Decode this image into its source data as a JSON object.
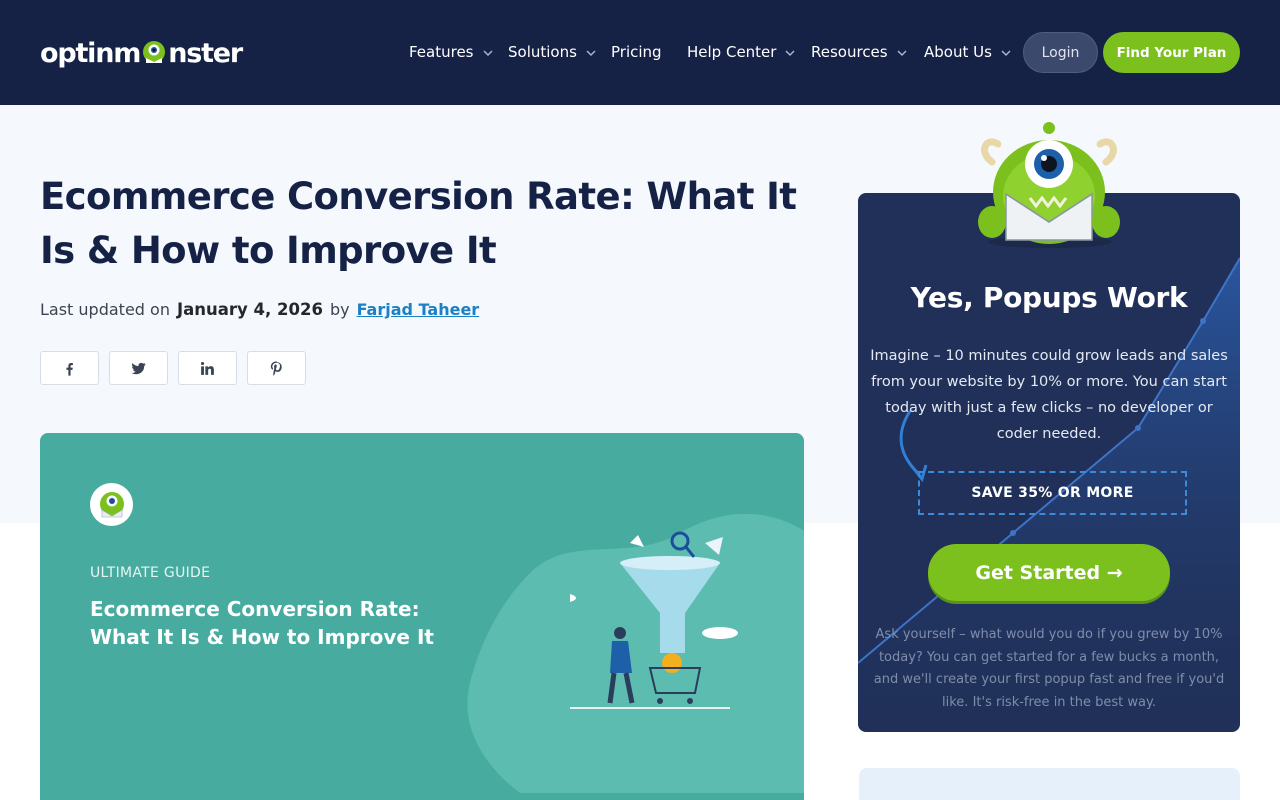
{
  "header": {
    "logo_pre": "optinm",
    "logo_post": "nster",
    "nav": [
      {
        "label": "Features",
        "has_dropdown": true
      },
      {
        "label": "Solutions",
        "has_dropdown": true
      },
      {
        "label": "Pricing",
        "has_dropdown": false
      },
      {
        "label": "Help Center",
        "has_dropdown": true
      },
      {
        "label": "Resources",
        "has_dropdown": true
      },
      {
        "label": "About Us",
        "has_dropdown": true
      }
    ],
    "login_label": "Login",
    "cta_label": "Find Your Plan"
  },
  "article": {
    "title": "Ecommerce Conversion Rate: What It Is & How to Improve It",
    "updated_prefix": "Last updated on",
    "date": "January 4, 2026",
    "by": "by",
    "author": "Farjad Taheer",
    "share_icons": [
      "facebook-icon",
      "twitter-icon",
      "linkedin-icon",
      "pinterest-icon"
    ]
  },
  "featured": {
    "kicker": "ULTIMATE GUIDE",
    "title": "Ecommerce Conversion Rate: What It Is & How to Improve It"
  },
  "sidebar": {
    "title": "Yes, Popups Work",
    "body": "Imagine – 10 minutes could grow leads and sales from your website by 10% or more. You can start today with just a few clicks – no developer or coder needed.",
    "save_label": "SAVE 35% OR MORE",
    "cta_label": "Get Started →",
    "footnote": "Ask yourself – what would you do if you grew by 10% today? You can get started for a few bucks a month, and we'll create your first popup fast and free if you'd like. It's risk-free in the best way."
  },
  "colors": {
    "header_bg": "#152246",
    "accent_green": "#7cc01e",
    "link_blue": "#1b80c5",
    "feature_teal": "#47ab9f",
    "card_bg": "#203058"
  }
}
